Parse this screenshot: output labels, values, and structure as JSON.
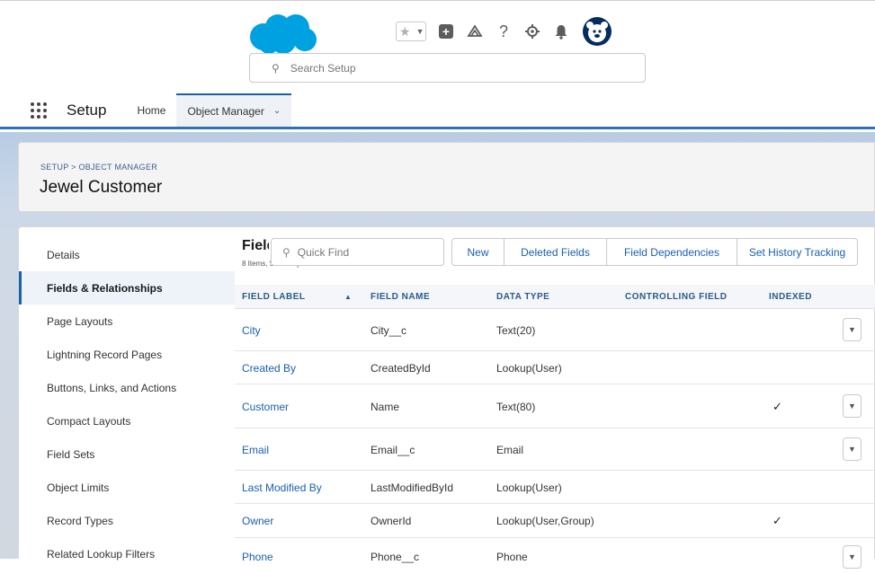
{
  "header": {
    "search": {
      "placeholder": "Search Setup"
    },
    "help_glyph": "?"
  },
  "context_bar": {
    "app_name": "Setup",
    "tabs": [
      {
        "label": "Home",
        "active": false
      },
      {
        "label": "Object Manager",
        "active": true
      }
    ]
  },
  "page_header": {
    "breadcrumb": "SETUP > OBJECT MANAGER",
    "title": "Jewel Customer"
  },
  "sidebar": {
    "items": [
      {
        "label": "Details"
      },
      {
        "label": "Fields & Relationships",
        "active": true
      },
      {
        "label": "Page Layouts"
      },
      {
        "label": "Lightning Record Pages"
      },
      {
        "label": "Buttons, Links, and Actions"
      },
      {
        "label": "Compact Layouts"
      },
      {
        "label": "Field Sets"
      },
      {
        "label": "Object Limits"
      },
      {
        "label": "Record Types"
      },
      {
        "label": "Related Lookup Filters"
      }
    ]
  },
  "fields_panel": {
    "title": "Fields & Relationships",
    "subtitle": "8 Items, Sorted by Field Label",
    "quick_find_placeholder": "Quick Find",
    "buttons": {
      "new": "New",
      "deleted_fields": "Deleted Fields",
      "field_dependencies": "Field Dependencies",
      "set_history_tracking": "Set History Tracking"
    }
  },
  "table": {
    "columns": {
      "field_label": "FIELD LABEL",
      "field_name": "FIELD NAME",
      "data_type": "DATA TYPE",
      "controlling_field": "CONTROLLING FIELD",
      "indexed": "INDEXED"
    },
    "sort_indicator": "▲",
    "check_glyph": "✓",
    "rows": [
      {
        "label": "City",
        "name": "City__c",
        "type": "Text(20)",
        "indexed": false,
        "has_action": true
      },
      {
        "label": "Created By",
        "name": "CreatedById",
        "type": "Lookup(User)",
        "indexed": false,
        "has_action": false
      },
      {
        "label": "Customer",
        "name": "Name",
        "type": "Text(80)",
        "indexed": true,
        "has_action": true
      },
      {
        "label": "Email",
        "name": "Email__c",
        "type": "Email",
        "indexed": false,
        "has_action": true
      },
      {
        "label": "Last Modified By",
        "name": "LastModifiedById",
        "type": "Lookup(User)",
        "indexed": false,
        "has_action": false
      },
      {
        "label": "Owner",
        "name": "OwnerId",
        "type": "Lookup(User,Group)",
        "indexed": true,
        "has_action": false
      },
      {
        "label": "Phone",
        "name": "Phone__c",
        "type": "Phone",
        "indexed": false,
        "has_action": true
      }
    ]
  },
  "colors": {
    "brand_blue": "#00a1e0",
    "link_blue": "#1b5fb0",
    "header_text": "#2c5a8c",
    "band_blue": "#b7cbe2"
  }
}
